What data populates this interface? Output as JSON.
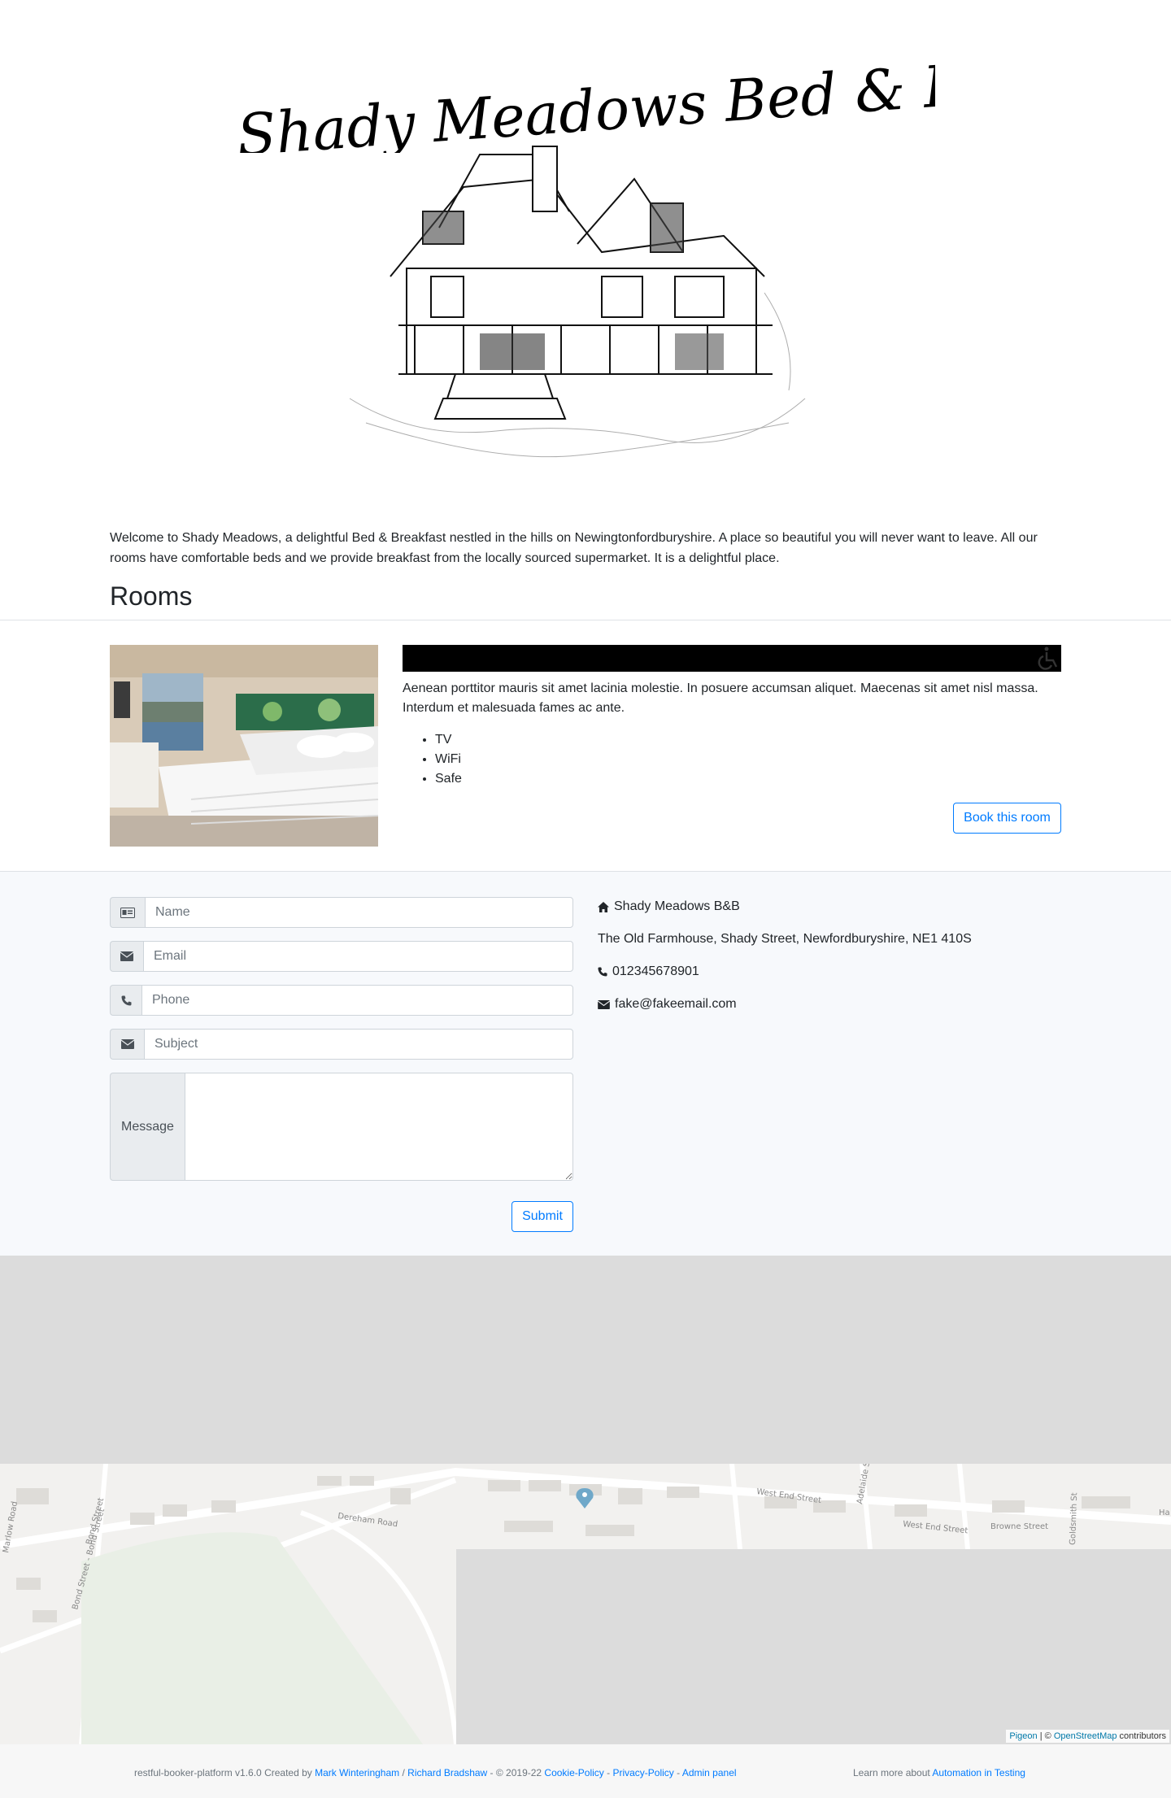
{
  "header": {
    "logo_text": "Shady Meadows Bed & Breakfast"
  },
  "intro": {
    "text": "Welcome to Shady Meadows, a delightful Bed & Breakfast nestled in the hills on Newingtonfordburyshire. A place so beautiful you will never want to leave. All our rooms have comfortable beds and we provide breakfast from the locally sourced supermarket. It is a delightful place."
  },
  "rooms": {
    "title": "Rooms",
    "items": [
      {
        "description": "Aenean porttitor mauris sit amet lacinia molestie. In posuere accumsan aliquet. Maecenas sit amet nisl massa. Interdum et malesuada fames ac ante.",
        "features": [
          "TV",
          "WiFi",
          "Safe"
        ],
        "accessible_icon": "wheelchair-icon",
        "book_label": "Book this room"
      }
    ]
  },
  "contact_form": {
    "name_placeholder": "Name",
    "email_placeholder": "Email",
    "phone_placeholder": "Phone",
    "subject_placeholder": "Subject",
    "message_label": "Message",
    "submit_label": "Submit",
    "icons": [
      "id-card-icon",
      "envelope-icon",
      "phone-icon",
      "envelope-icon"
    ]
  },
  "contact_info": {
    "name": "Shady Meadows B&B",
    "address": "The Old Farmhouse, Shady Street, Newfordburyshire, NE1 410S",
    "phone": "012345678901",
    "email": "fake@fakeemail.com"
  },
  "map": {
    "streets": [
      "Dereham Road",
      "West End Street",
      "West End Street",
      "Browne Street",
      "Adelaide St",
      "Bond Street - Bond Street",
      "Bond Street",
      "Goldsmith St",
      "Marlow Road",
      "Ha"
    ],
    "attribution_pigeon": "Pigeon",
    "attribution_sep": " | © ",
    "attribution_osm": "OpenStreetMap",
    "attribution_suffix": " contributors"
  },
  "footer": {
    "prefix": "restful-booker-platform v1.6.0 Created by ",
    "author1": "Mark Winteringham",
    "sep1": " / ",
    "author2": "Richard Bradshaw",
    "copyright": " - © 2019-22 ",
    "cookie": "Cookie-Policy",
    "dash1": " - ",
    "privacy": "Privacy-Policy",
    "dash2": " - ",
    "admin": "Admin panel",
    "learn_prefix": "Learn more about ",
    "learn_link": "Automation in Testing"
  },
  "colors": {
    "primary": "#007bff",
    "contact_bg": "#f7f9fc",
    "map_gray": "#dcdcdc"
  }
}
